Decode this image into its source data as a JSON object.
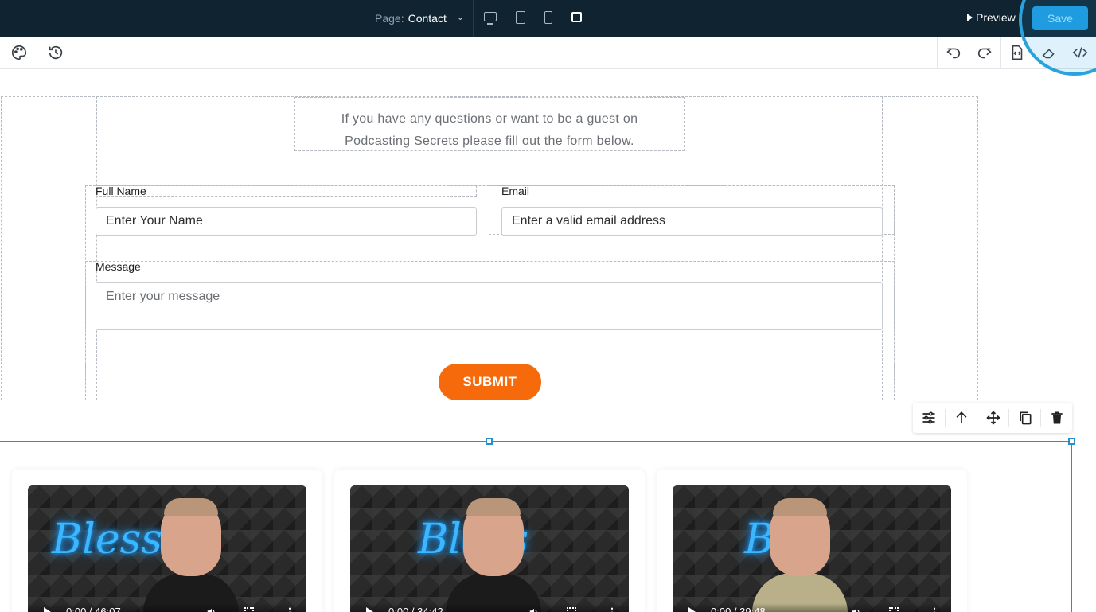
{
  "topbar": {
    "page_label": "Page:",
    "page_value": "Contact",
    "preview_label": "Preview",
    "save_label": "Save"
  },
  "form": {
    "intro_line1": "If you have any questions or want to be a guest on",
    "intro_line2": "Podcasting Secrets please fill out the form below.",
    "full_name_label": "Full Name",
    "full_name_placeholder": "Enter Your Name",
    "email_label": "Email",
    "email_placeholder": "Enter a valid email address",
    "message_label": "Message",
    "message_placeholder": "Enter your message",
    "submit_label": "SUBMIT"
  },
  "videos": [
    {
      "time": "0:00 / 46:07",
      "neon": "Blessed"
    },
    {
      "time": "0:00 / 34:42",
      "neon": "Bless"
    },
    {
      "time": "0:00 / 39:48",
      "neon": "B"
    }
  ],
  "colors": {
    "topbar_bg": "#0f2330",
    "save_button": "#1e9be0",
    "submit_button": "#f76a0c",
    "selection": "#2a8fc7"
  },
  "icons": {
    "toolbar_left": [
      "palette-icon",
      "history-icon"
    ],
    "toolbar_right": [
      "undo-icon",
      "redo-icon",
      "code-file-icon",
      "eraser-icon",
      "code-icon"
    ],
    "element_toolbar": [
      "settings-sliders-icon",
      "arrow-up-icon",
      "move-icon",
      "duplicate-icon",
      "trash-icon"
    ],
    "devices": [
      "desktop-icon",
      "tablet-icon",
      "mobile-icon",
      "square-icon"
    ]
  }
}
